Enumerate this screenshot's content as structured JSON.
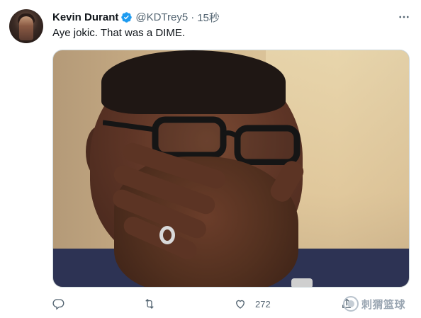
{
  "user": {
    "display_name": "Kevin Durant",
    "handle": "@KDTrey5",
    "separator": "·",
    "time": "15秒",
    "verified": true,
    "verified_color": "#1d9bf0"
  },
  "tweet": {
    "text": "Aye jokic. That was a DIME."
  },
  "media": {
    "type": "photo"
  },
  "actions": {
    "reply": {
      "icon": "reply-icon",
      "count": ""
    },
    "retweet": {
      "icon": "retweet-icon",
      "count": ""
    },
    "like": {
      "icon": "like-icon",
      "count": "272"
    },
    "share": {
      "icon": "share-icon",
      "count": ""
    }
  },
  "watermark": {
    "text": "刺猬篮球"
  },
  "colors": {
    "text_primary": "#0f1419",
    "text_secondary": "#536471",
    "border": "#cfd9de"
  }
}
